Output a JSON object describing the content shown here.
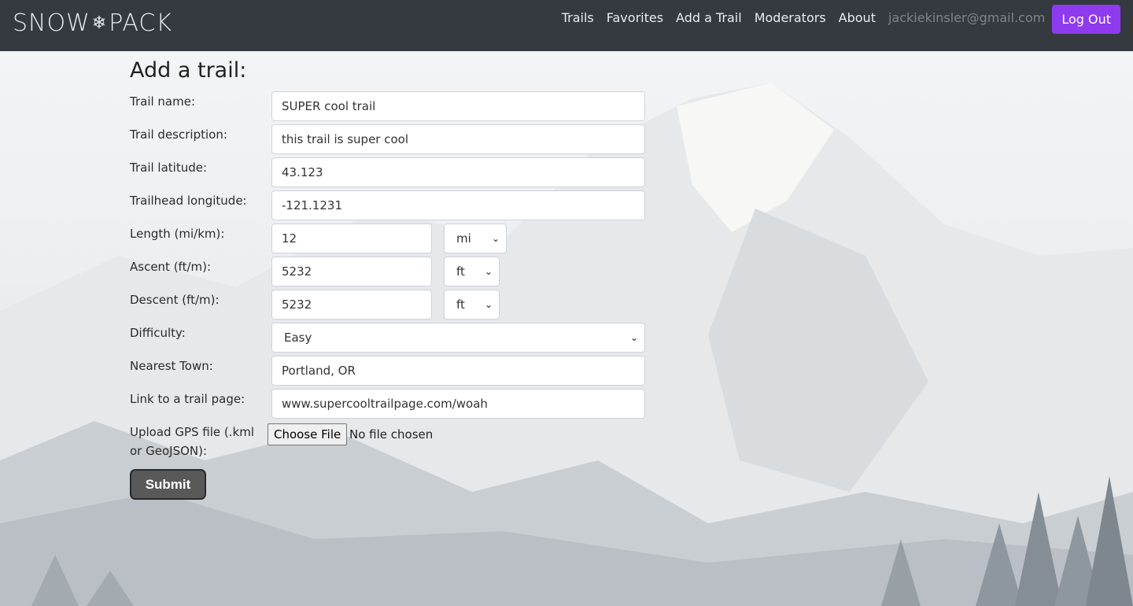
{
  "navbar": {
    "brand_left": "SNOW",
    "brand_icon": "snowflake-icon",
    "brand_right": "PACK",
    "links": [
      "Trails",
      "Favorites",
      "Add a Trail",
      "Moderators",
      "About"
    ],
    "user_email": "jackiekinsler@gmail.com",
    "logout_label": "Log Out",
    "logout_color": "#8e3bef"
  },
  "form": {
    "title": "Add a trail:",
    "trail_name": {
      "label": "Trail name:",
      "value": "SUPER cool trail"
    },
    "trail_description": {
      "label": "Trail description:",
      "value": "this trail is super cool"
    },
    "trail_latitude": {
      "label": "Trail latitude:",
      "value": "43.123"
    },
    "trailhead_longitude": {
      "label": "Trailhead longitude:",
      "value": "-121.1231"
    },
    "length": {
      "label": "Length (mi/km):",
      "value": "12",
      "unit": "mi"
    },
    "ascent": {
      "label": "Ascent (ft/m):",
      "value": "5232",
      "unit": "ft"
    },
    "descent": {
      "label": "Descent (ft/m):",
      "value": "5232",
      "unit": "ft"
    },
    "difficulty": {
      "label": "Difficulty:",
      "value": "Easy"
    },
    "nearest_town": {
      "label": "Nearest Town:",
      "value": "Portland, OR"
    },
    "trail_link": {
      "label": "Link to a trail page:",
      "value": "www.supercooltrailpage.com/woah"
    },
    "gps_upload": {
      "label": "Upload GPS file (.kml or GeoJSON):",
      "button": "Choose File",
      "status": "No file chosen"
    },
    "submit_label": "Submit"
  }
}
